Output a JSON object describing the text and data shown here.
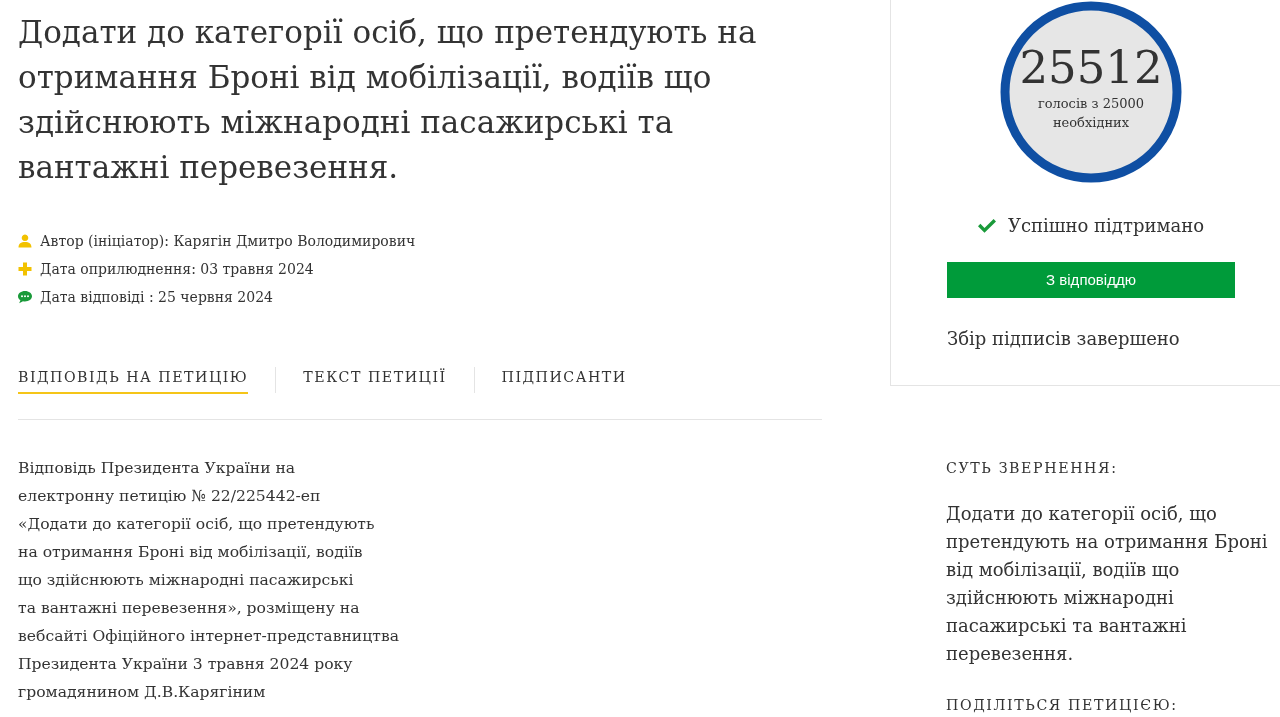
{
  "title": "Додати до категорії осіб, що претендують на отримання Броні від мобілізації, водіїв що здійснюють міжнародні пасажирські та вантажні перевезення.",
  "meta": [
    {
      "kind": "author",
      "text": "Автор (ініціатор): Карягін Дмитро Володимирович"
    },
    {
      "kind": "published",
      "text": "Дата оприлюднення: 03 травня 2024"
    },
    {
      "kind": "answered",
      "text": "Дата відповіді : 25 червня 2024"
    }
  ],
  "tabs": [
    {
      "label": "ВІДПОВІДЬ НА ПЕТИЦІЮ",
      "selected": true
    },
    {
      "label": "ТЕКСТ ПЕТИЦІЇ",
      "selected": false
    },
    {
      "label": "ПІДПИСАНТИ",
      "selected": false
    }
  ],
  "answer_text": "Відповідь Президента України на\nелектронну петицію № 22/225442-еп\n«Додати до категорії осіб, що претендують\nна отримання Броні від мобілізації, водіїв\nщо здійснюють міжнародні пасажирські\nта вантажні перевезення», розміщену на\nвебсайті Офіційного інтернет-представництва\nПрезидента України 3 травня 2024 року\nгромадянином Д.В.Карягіним",
  "votes": {
    "count": "25512",
    "caption": "голосів з 25000 необхідних"
  },
  "status": {
    "text": "Успішно підтримано",
    "success": true
  },
  "answer_banner": "З відповіддю",
  "collection_status": "Збір підписів завершено",
  "summary": {
    "heading": "СУТЬ ЗВЕРНЕННЯ:",
    "text": "Додати до категорії осіб, що претендують на отримання Броні від мобілізації, водіїв що здійснюють міжнародні пасажирські та вантажні перевезення."
  },
  "share": {
    "heading": "ПОДІЛІТЬСЯ ПЕТИЦІЄЮ:"
  }
}
